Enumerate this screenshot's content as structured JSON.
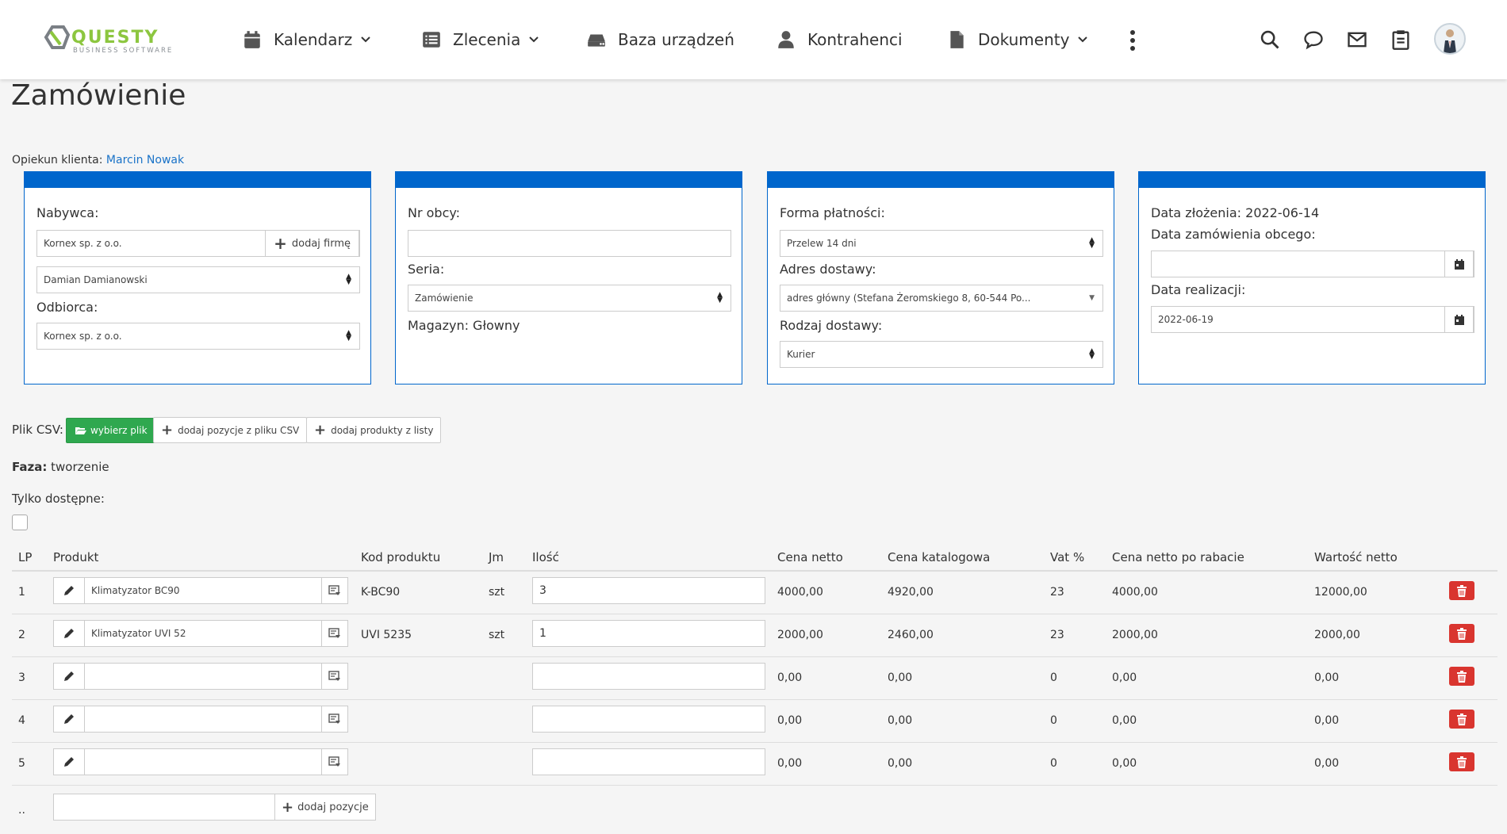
{
  "nav": {
    "logo_text": "QUESTY",
    "logo_sub": "BUSINESS SOFTWARE",
    "items": [
      {
        "label": "Kalendarz"
      },
      {
        "label": "Zlecenia"
      },
      {
        "label": "Baza urządzeń"
      },
      {
        "label": "Kontrahenci"
      },
      {
        "label": "Dokumenty"
      }
    ]
  },
  "page": {
    "title": "Zamówienie",
    "opiekun_label": "Opiekun klienta:",
    "opiekun_name": "Marcin Nowak"
  },
  "panel1": {
    "nabywca_label": "Nabywca:",
    "nabywca_value": "Kornex sp. z o.o.",
    "add_firm": "dodaj firmę",
    "contact_value": "Damian Damianowski",
    "odbiorca_label": "Odbiorca:",
    "odbiorca_value": "Kornex sp. z o.o."
  },
  "panel2": {
    "nr_obcy_label": "Nr obcy:",
    "nr_obcy_value": "",
    "seria_label": "Seria:",
    "seria_value": "Zamówienie",
    "magazyn": "Magazyn: Głowny"
  },
  "panel3": {
    "forma_label": "Forma płatności:",
    "forma_value": "Przelew 14 dni",
    "adres_label": "Adres dostawy:",
    "adres_value": "adres główny (Stefana Żeromskiego 8, 60-544 Po...",
    "rodzaj_label": "Rodzaj dostawy:",
    "rodzaj_value": "Kurier"
  },
  "panel4": {
    "data_zlozenia": "Data złożenia: 2022-06-14",
    "data_obcego_label": "Data zamówienia obcego:",
    "data_obcego_value": "",
    "data_realizacji_label": "Data realizacji:",
    "data_realizacji_value": "2022-06-19"
  },
  "csv": {
    "label": "Plik CSV:",
    "choose": "wybierz plik",
    "add_csv": "dodaj pozycje z pliku CSV",
    "add_list": "dodaj produkty z listy"
  },
  "status": {
    "faza_label": "Faza:",
    "faza_value": "tworzenie",
    "tylko_label": "Tylko dostępne:"
  },
  "table": {
    "headers": [
      "LP",
      "Produkt",
      "Kod produktu",
      "Jm",
      "Ilość",
      "Cena netto",
      "Cena katalogowa",
      "Vat %",
      "Cena netto po rabacie",
      "Wartość netto"
    ],
    "rows": [
      {
        "lp": "1",
        "produkt": "Klimatyzator BC90",
        "kod": "K-BC90",
        "jm": "szt",
        "ilosc": "3",
        "cena_netto": "4000,00",
        "cena_kat": "4920,00",
        "vat": "23",
        "cena_rabat": "4000,00",
        "wartosc": "12000,00"
      },
      {
        "lp": "2",
        "produkt": "Klimatyzator UVI 52",
        "kod": "UVI 5235",
        "jm": "szt",
        "ilosc": "1",
        "cena_netto": "2000,00",
        "cena_kat": "2460,00",
        "vat": "23",
        "cena_rabat": "2000,00",
        "wartosc": "2000,00"
      },
      {
        "lp": "3",
        "produkt": "",
        "kod": "",
        "jm": "",
        "ilosc": "",
        "cena_netto": "0,00",
        "cena_kat": "0,00",
        "vat": "0",
        "cena_rabat": "0,00",
        "wartosc": "0,00"
      },
      {
        "lp": "4",
        "produkt": "",
        "kod": "",
        "jm": "",
        "ilosc": "",
        "cena_netto": "0,00",
        "cena_kat": "0,00",
        "vat": "0",
        "cena_rabat": "0,00",
        "wartosc": "0,00"
      },
      {
        "lp": "5",
        "produkt": "",
        "kod": "",
        "jm": "",
        "ilosc": "",
        "cena_netto": "0,00",
        "cena_kat": "0,00",
        "vat": "0",
        "cena_rabat": "0,00",
        "wartosc": "0,00"
      }
    ],
    "last_lp": "..",
    "add_position": "dodaj pozycje"
  },
  "colors": {
    "brand_blue": "#0066cc",
    "green": "#2fa84f",
    "danger": "#d9352f",
    "logo_green": "#7fbf3f"
  }
}
